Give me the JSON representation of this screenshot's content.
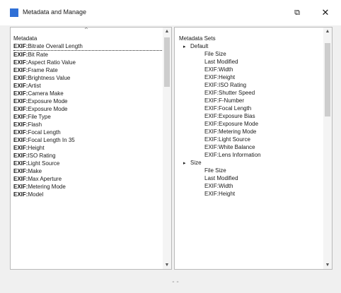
{
  "window": {
    "title": "Metadata and Manage",
    "restore_glyph": "⧉",
    "close_glyph": "✕"
  },
  "left_list": {
    "header": "Metadata",
    "sort_glyph": "^",
    "items": [
      {
        "pfx": "EXIF:",
        "rest": "Bitrate Overall Length",
        "selected": true
      },
      {
        "pfx": "EXIF:",
        "rest": "Bit Rate"
      },
      {
        "pfx": "EXIF:",
        "rest": "Aspect Ratio Value"
      },
      {
        "pfx": "EXIF:",
        "rest": "Frame Rate"
      },
      {
        "pfx": "EXIF:",
        "rest": "Brightness Value"
      },
      {
        "pfx": "EXIF:",
        "rest": "Artist"
      },
      {
        "pfx": "EXIF:",
        "rest": "Camera Make"
      },
      {
        "pfx": "EXIF:",
        "rest": "Exposure Mode"
      },
      {
        "pfx": "EXIF:",
        "rest": "Exposure Mode"
      },
      {
        "pfx": "EXIF:",
        "rest": "File Type"
      },
      {
        "pfx": "EXIF:",
        "rest": "Flash"
      },
      {
        "pfx": "EXIF:",
        "rest": "Focal Length"
      },
      {
        "pfx": "EXIF:",
        "rest": "Focal Length In 35"
      },
      {
        "pfx": "EXIF:",
        "rest": "Height"
      },
      {
        "pfx": "EXIF:",
        "rest": "ISO Rating"
      },
      {
        "pfx": "EXIF:",
        "rest": "Light Source"
      },
      {
        "pfx": "EXIF:",
        "rest": "Make"
      },
      {
        "pfx": "EXIF:",
        "rest": "Max Aperture"
      },
      {
        "pfx": "EXIF:",
        "rest": "Metering Mode"
      },
      {
        "pfx": "EXIF:",
        "rest": "Model"
      }
    ]
  },
  "right_tree": {
    "root": "Metadata Sets",
    "groups": [
      {
        "name": "Default",
        "items": [
          "File Size",
          "Last Modified",
          "EXIF:Width",
          "EXIF:Height",
          "EXIF:ISO Rating",
          "EXIF:Shutter Speed",
          "EXIF:F-Number",
          "EXIF:Focal Length",
          "EXIF:Exposure Bias",
          "EXIF:Exposure Mode",
          "EXIF:Metering Mode",
          "EXIF:Light Source",
          "EXIF:White Balance",
          "EXIF:Lens Information"
        ]
      },
      {
        "name": "Size",
        "items": [
          "File Size",
          "Last Modified",
          "EXIF:Width",
          "EXIF:Height"
        ]
      }
    ]
  },
  "icons": {
    "expanded": "▸",
    "scroll_up": "▲",
    "scroll_down": "▼",
    "grip": "- -"
  }
}
